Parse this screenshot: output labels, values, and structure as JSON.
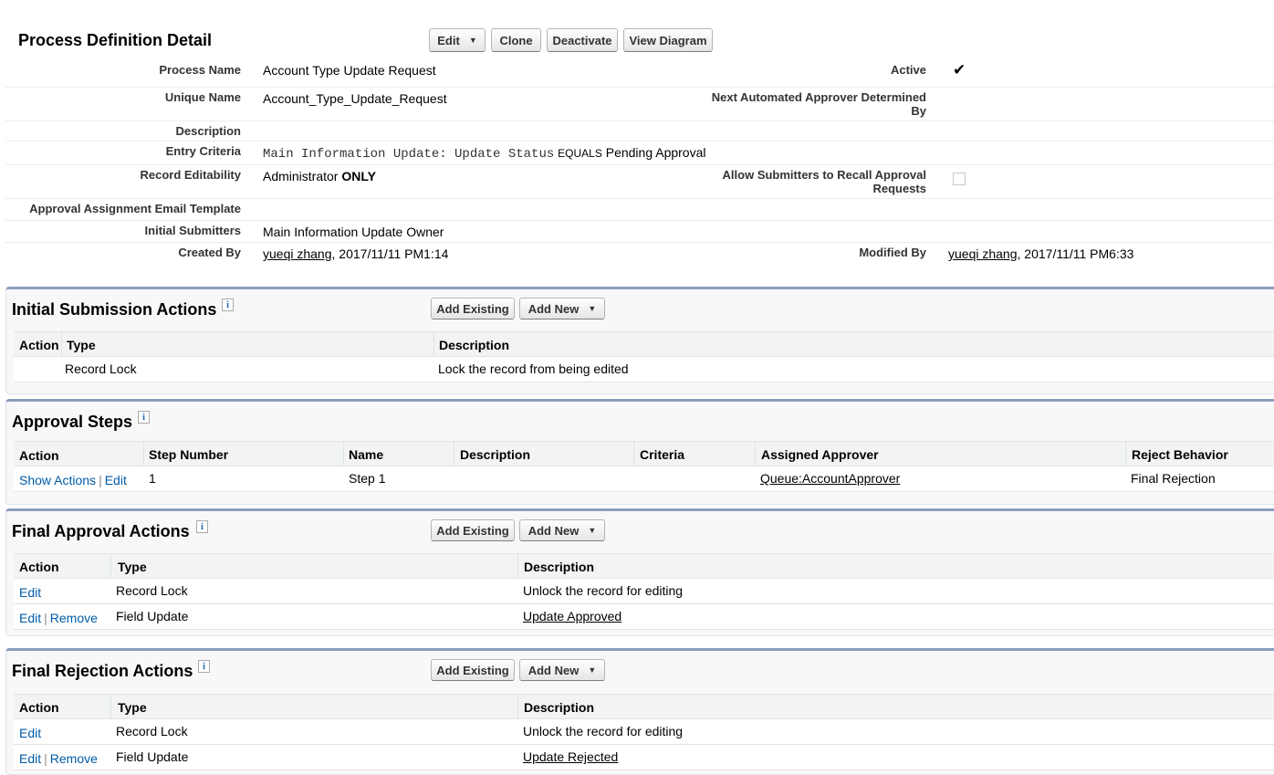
{
  "detail": {
    "title": "Process Definition Detail",
    "buttons": {
      "edit": "Edit",
      "clone": "Clone",
      "deactivate": "Deactivate",
      "view_diagram": "View Diagram"
    },
    "fields": {
      "process_name_label": "Process Name",
      "process_name": "Account Type Update Request",
      "active_label": "Active",
      "unique_name_label": "Unique Name",
      "unique_name": "Account_Type_Update_Request",
      "next_approver_label_1": "Next Automated Approver Determined",
      "next_approver_label_2": "By",
      "description_label": "Description",
      "entry_criteria_label": "Entry Criteria",
      "entry_criteria_field": "Main Information Update: Update Status",
      "entry_criteria_op": "EQUALS",
      "entry_criteria_value": "Pending Approval",
      "record_editability_label": "Record Editability",
      "record_editability_prefix": "Administrator",
      "record_editability_bold": "ONLY",
      "allow_recall_label_1": "Allow Submitters to Recall Approval",
      "allow_recall_label_2": "Requests",
      "email_template_label": "Approval Assignment Email Template",
      "initial_submitters_label": "Initial Submitters",
      "initial_submitters": "Main Information Update Owner",
      "created_by_label": "Created By",
      "created_by_user": "yueqi zhang",
      "created_by_date": ", 2017/11/11 PM1:14",
      "modified_by_label": "Modified By",
      "modified_by_user": "yueqi zhang",
      "modified_by_date": ", 2017/11/11 PM6:33"
    }
  },
  "common": {
    "add_existing": "Add Existing",
    "add_new": "Add New",
    "info": "i",
    "sep": "|"
  },
  "initial_submission": {
    "title": "Initial Submission Actions",
    "headers": [
      "Action",
      "Type",
      "Description"
    ],
    "rows": [
      {
        "action": "",
        "type": "Record Lock",
        "description": "Lock the record from being edited"
      }
    ]
  },
  "approval_steps": {
    "title": "Approval Steps",
    "headers": [
      "Action",
      "Step Number",
      "Name",
      "Description",
      "Criteria",
      "Assigned Approver",
      "Reject Behavior"
    ],
    "rows": [
      {
        "action_1": "Show Actions",
        "action_2": "Edit",
        "step_number": "1",
        "name": "Step 1",
        "description": "",
        "criteria": "",
        "assigned_approver": "Queue:AccountApprover",
        "reject_behavior": "Final Rejection"
      }
    ]
  },
  "final_approval": {
    "title": "Final Approval Actions",
    "headers": [
      "Action",
      "Type",
      "Description"
    ],
    "rows": [
      {
        "action_1": "Edit",
        "action_2": "",
        "type": "Record Lock",
        "description": "Unlock the record for editing"
      },
      {
        "action_1": "Edit",
        "action_2": "Remove",
        "type": "Field Update",
        "description": "Update Approved"
      }
    ]
  },
  "final_rejection": {
    "title": "Final Rejection Actions",
    "headers": [
      "Action",
      "Type",
      "Description"
    ],
    "rows": [
      {
        "action_1": "Edit",
        "action_2": "",
        "type": "Record Lock",
        "description": "Unlock the record for editing"
      },
      {
        "action_1": "Edit",
        "action_2": "Remove",
        "type": "Field Update",
        "description": "Update Rejected"
      }
    ]
  },
  "colors": {
    "panel_border": "#8a9ebe",
    "link_blue": "#015ba7",
    "panel_bg": "#f8f8f8"
  }
}
